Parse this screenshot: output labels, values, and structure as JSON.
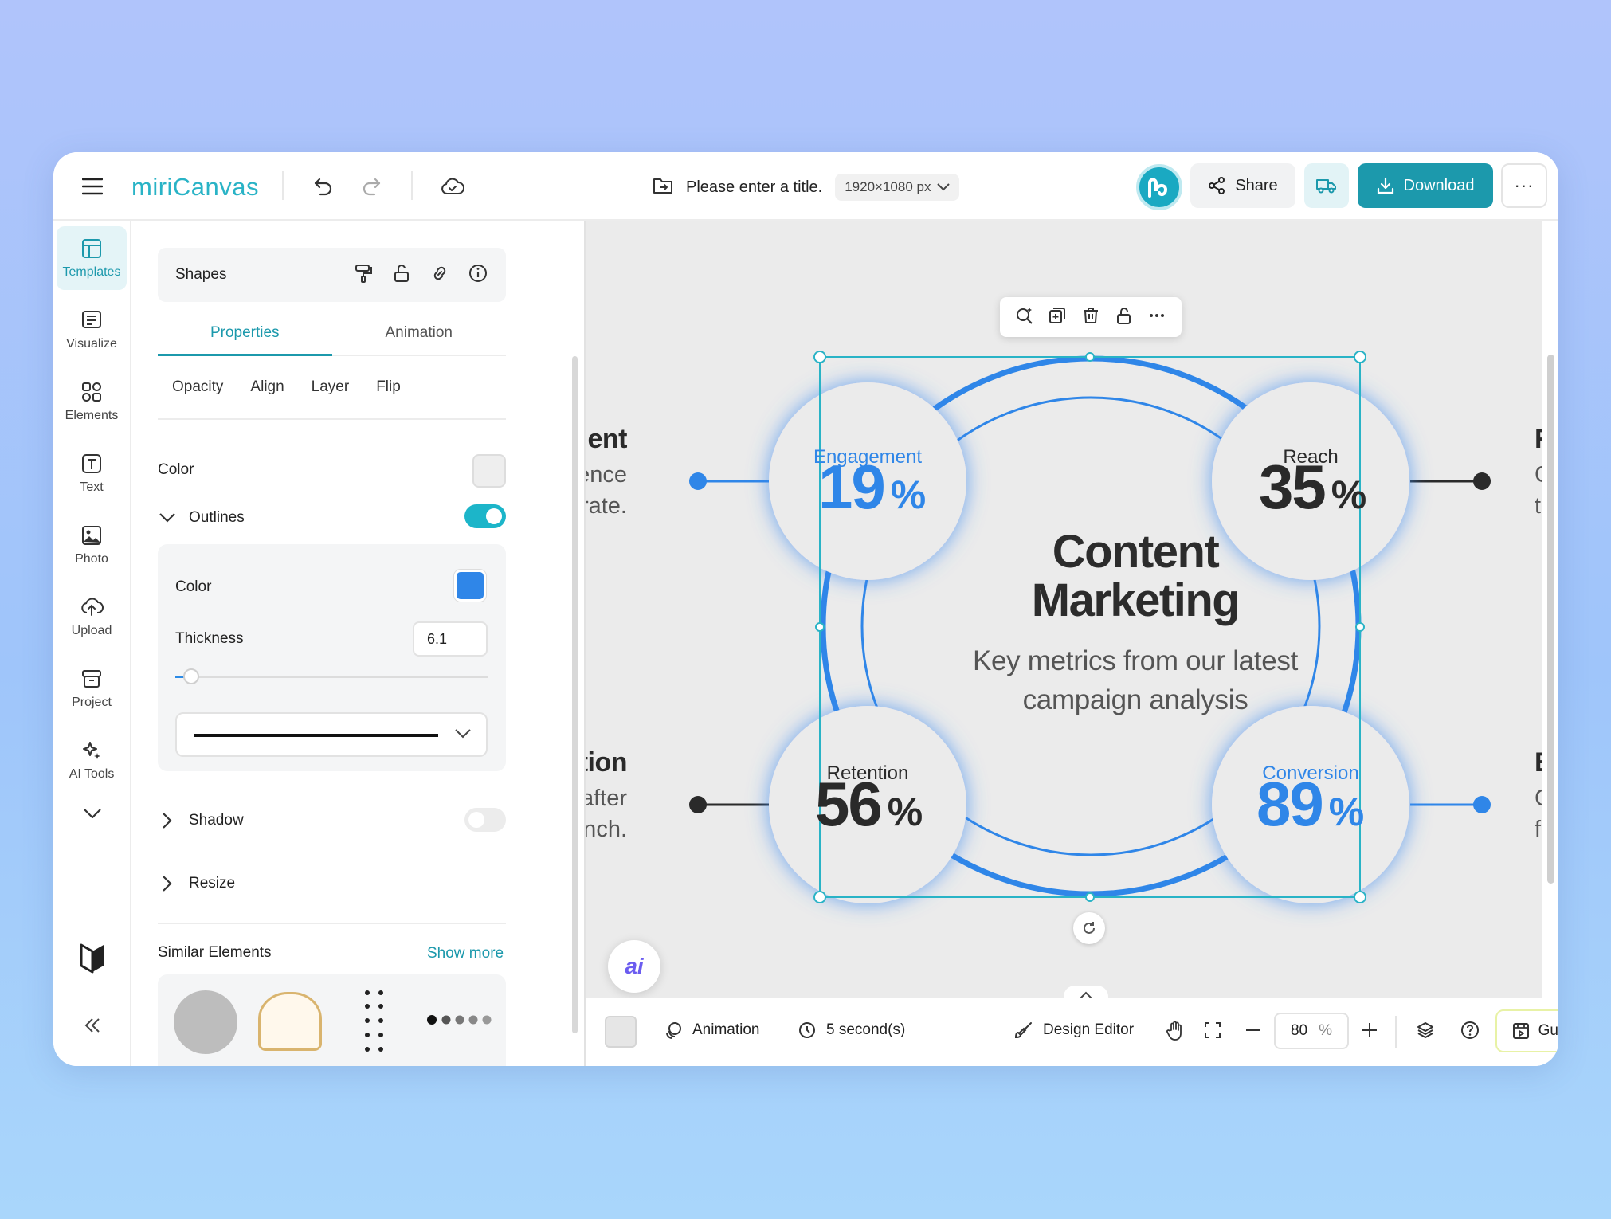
{
  "app": {
    "logo_text": "miri",
    "logo_text_bold": "Canvas",
    "doc_title": "Please enter a title.",
    "canvas_size": "1920×1080 px",
    "share_label": "Share",
    "download_label": "Download",
    "more_label": "···"
  },
  "leftnav": {
    "items": [
      {
        "label": "Templates",
        "icon": "templates-icon"
      },
      {
        "label": "Visualize",
        "icon": "visualize-icon"
      },
      {
        "label": "Elements",
        "icon": "elements-icon"
      },
      {
        "label": "Text",
        "icon": "text-icon"
      },
      {
        "label": "Photo",
        "icon": "photo-icon"
      },
      {
        "label": "Upload",
        "icon": "upload-icon"
      },
      {
        "label": "Project",
        "icon": "project-icon"
      },
      {
        "label": "AI Tools",
        "icon": "ai-tools-icon"
      }
    ]
  },
  "panel": {
    "element_type": "Shapes",
    "tabs": [
      "Properties",
      "Animation"
    ],
    "subtabs": [
      "Opacity",
      "Align",
      "Layer",
      "Flip"
    ],
    "color_label": "Color",
    "fill_color": "#eeeeee",
    "outlines_label": "Outlines",
    "outlines_on": true,
    "outline_color_label": "Color",
    "outline_color": "#2f86e8",
    "thickness_label": "Thickness",
    "thickness_value": "6.1",
    "shadow_label": "Shadow",
    "shadow_on": false,
    "resize_label": "Resize",
    "similar_label": "Similar Elements",
    "show_more_label": "Show more"
  },
  "canvas": {
    "title_line1": "Content",
    "title_line2": "Marketing",
    "subtitle_line1": "Key metrics from our latest",
    "subtitle_line2": "campaign analysis",
    "metrics": [
      {
        "label": "Engagement",
        "value": "19",
        "unit": "%"
      },
      {
        "label": "Reach",
        "value": "35",
        "unit": "%"
      },
      {
        "label": "Retention",
        "value": "56",
        "unit": "%"
      },
      {
        "label": "Conversion",
        "value": "89",
        "unit": "%"
      }
    ],
    "left_top_head": "ement",
    "left_top_sub1": "udience",
    "left_top_sub2": "nt rate.",
    "left_bottom_head": "ention",
    "left_bottom_sub1": "te after",
    "left_bottom_sub2": "launch.",
    "right_top_head": "Reac",
    "right_top_sub1": "Growt",
    "right_top_sub2": "this qu",
    "right_bottom_head": "Enter",
    "right_bottom_sub1": "Conve",
    "right_bottom_sub2": "from t",
    "ai_label": "ai"
  },
  "bottombar": {
    "animation_label": "Animation",
    "duration_label": "5 second(s)",
    "editor_label": "Design Editor",
    "zoom_value": "80",
    "zoom_unit": "%",
    "guide_label": "Guide"
  },
  "colors": {
    "accent": "#1c99ac",
    "blue": "#2f86e8",
    "dark": "#2a2a2a"
  }
}
